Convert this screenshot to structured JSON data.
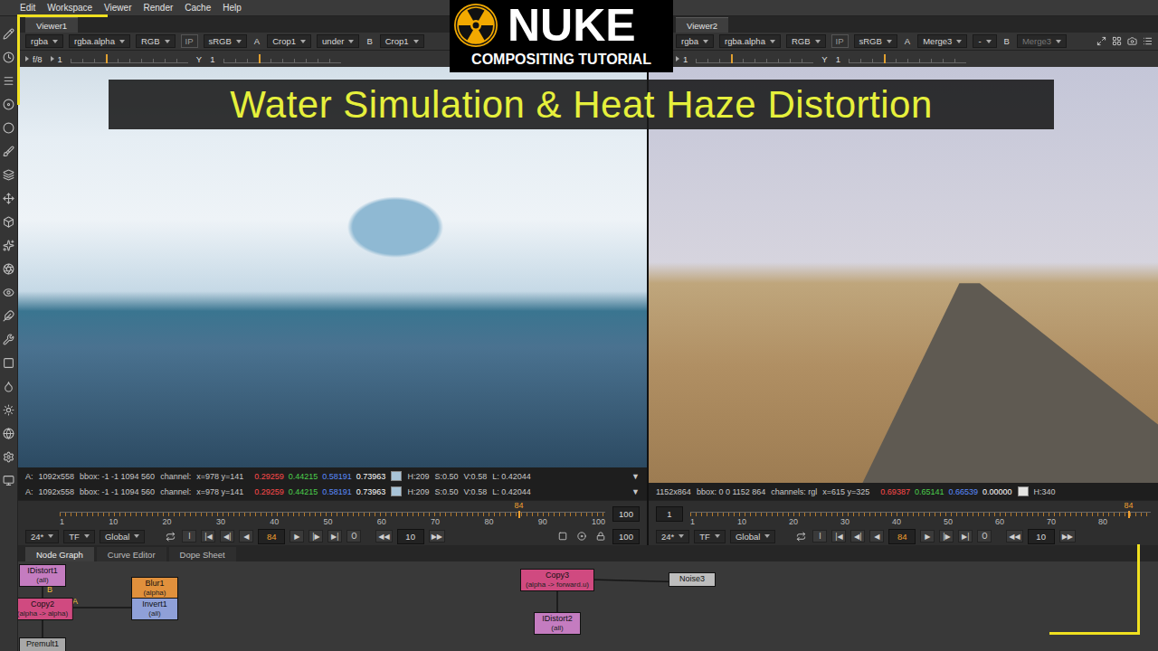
{
  "menu": [
    "Edit",
    "Workspace",
    "Viewer",
    "Render",
    "Cache",
    "Help"
  ],
  "logo": {
    "title": "NUKE",
    "subtitle": "COMPOSITING TUTORIAL"
  },
  "banner": {
    "title": "Water Simulation & Heat Haze Distortion"
  },
  "viewers": [
    {
      "tab": {
        "label": "Viewer1",
        "selected": true
      },
      "controls": [
        {
          "kind": "dropdown",
          "text": "rgba",
          "disabled": false
        },
        {
          "kind": "dropdown",
          "text": "rgba.alpha",
          "disabled": false
        },
        {
          "kind": "dropdown",
          "text": "RGB",
          "disabled": false
        },
        {
          "kind": "toggle",
          "text": "IP",
          "disabled": false
        },
        {
          "kind": "dropdown",
          "text": "sRGB",
          "disabled": false
        },
        {
          "kind": "label",
          "text": "A",
          "disabled": false
        },
        {
          "kind": "dropdown",
          "text": "Crop1",
          "disabled": false
        },
        {
          "kind": "dropdown",
          "text": "under",
          "disabled": false
        },
        {
          "kind": "label",
          "text": "B",
          "disabled": false
        },
        {
          "kind": "dropdown",
          "text": "Crop1",
          "disabled": false
        }
      ],
      "settings": [
        {
          "kind": "text",
          "text": "f/8",
          "arrow": true
        },
        {
          "kind": "text",
          "text": "1",
          "arrow": true
        },
        {
          "kind": "slider",
          "level": 0.3
        },
        {
          "kind": "text",
          "text": "Y",
          "arrow": false
        },
        {
          "kind": "text",
          "text": "1",
          "arrow": false
        },
        {
          "kind": "slider",
          "level": 0.3
        }
      ],
      "image": {
        "kind": "iceberg"
      },
      "info": [
        {
          "segments": [
            "A:",
            "1092x558",
            "bbox: -1 -1 1094 560",
            "channel:",
            "x=978 y=141"
          ],
          "values": [
            {
              "text": "0.29259",
              "color": "#ff4a4a"
            },
            {
              "text": "0.44215",
              "color": "#4cd04c"
            },
            {
              "text": "0.58191",
              "color": "#5b8cff"
            },
            {
              "text": "0.73963",
              "color": "#ffffff"
            }
          ],
          "swatch": "#a9c4d8",
          "hsv": [
            "H:209",
            "S:0.50",
            "V:0.58",
            "L: 0.42044"
          ],
          "arrow": "▼"
        },
        {
          "segments": [
            "A:",
            "1092x558",
            "bbox: -1 -1 1094 560",
            "channel:",
            "x=978 y=141"
          ],
          "values": [
            {
              "text": "0.29259",
              "color": "#ff4a4a"
            },
            {
              "text": "0.44215",
              "color": "#4cd04c"
            },
            {
              "text": "0.58191",
              "color": "#5b8cff"
            },
            {
              "text": "0.73963",
              "color": "#ffffff"
            }
          ],
          "swatch": "#a9c4d8",
          "hsv": [
            "H:209",
            "S:0.50",
            "V:0.58",
            "L: 0.42044"
          ],
          "arrow": "▼"
        }
      ],
      "timeline": {
        "ticks": [
          "1",
          "10",
          "20",
          "30",
          "40",
          "50",
          "60",
          "70",
          "80",
          "90",
          "100"
        ],
        "current": "84",
        "level": 0.84,
        "field": {
          "text": "100",
          "side": "right"
        }
      },
      "playback": {
        "selects": [
          "24*",
          "TF",
          "Global"
        ],
        "transport_back": [
          "I",
          "|◀",
          "◀|",
          "◀"
        ],
        "frame": "84",
        "transport_fwd": [
          "▶",
          "|▶",
          "▶|",
          "O"
        ],
        "step": {
          "back": "◀◀",
          "value": "10",
          "forward": "▶▶"
        },
        "end": "100"
      }
    },
    {
      "tab": {
        "label": "Viewer2",
        "selected": true
      },
      "controls": [
        {
          "kind": "dropdown",
          "text": "rgba",
          "disabled": false
        },
        {
          "kind": "dropdown",
          "text": "rgba.alpha",
          "disabled": false
        },
        {
          "kind": "dropdown",
          "text": "RGB",
          "disabled": false
        },
        {
          "kind": "toggle",
          "text": "IP",
          "disabled": false
        },
        {
          "kind": "dropdown",
          "text": "sRGB",
          "disabled": false
        },
        {
          "kind": "label",
          "text": "A",
          "disabled": false
        },
        {
          "kind": "dropdown",
          "text": "Merge3",
          "disabled": false
        },
        {
          "kind": "dropdown",
          "text": "-",
          "disabled": false
        },
        {
          "kind": "label",
          "text": "B",
          "disabled": false
        },
        {
          "kind": "dropdown",
          "text": "Merge3",
          "disabled": true
        }
      ],
      "settings": [
        {
          "kind": "text",
          "text": "1",
          "arrow": true
        },
        {
          "kind": "slider",
          "level": 0.3
        },
        {
          "kind": "text",
          "text": "Y",
          "arrow": false
        },
        {
          "kind": "text",
          "text": "1",
          "arrow": false
        },
        {
          "kind": "slider",
          "level": 0.3
        }
      ],
      "image": {
        "kind": "desert"
      },
      "info": [
        {
          "segments": [
            "1152x864",
            "bbox: 0 0 1152 864",
            "channels: rgl",
            "x=615 y=325"
          ],
          "values": [
            {
              "text": "0.69387",
              "color": "#ff4a4a"
            },
            {
              "text": "0.65141",
              "color": "#4cd04c"
            },
            {
              "text": "0.66539",
              "color": "#5b8cff"
            },
            {
              "text": "0.00000",
              "color": "#ffffff"
            }
          ],
          "swatch": "#e4e4e2",
          "hsv": [
            "H:340"
          ]
        }
      ],
      "timeline": {
        "ticks": [
          "1",
          "10",
          "20",
          "30",
          "40",
          "50",
          "60",
          "70",
          "80"
        ],
        "current": "84",
        "level": 0.95,
        "field": {
          "text": "1",
          "side": "left"
        }
      },
      "playback": {
        "selects": [
          "24*",
          "TF",
          "Global"
        ],
        "transport_back": [
          "I",
          "|◀",
          "◀|",
          "◀"
        ],
        "frame": "84",
        "transport_fwd": [
          "▶",
          "|▶",
          "▶|",
          "O"
        ],
        "step": {
          "back": "◀◀",
          "value": "10",
          "forward": "▶▶"
        }
      }
    }
  ],
  "node_graph": {
    "tabs": [
      {
        "label": "Node Graph",
        "selected": true
      },
      {
        "label": "Curve Editor",
        "selected": false
      },
      {
        "label": "Dope Sheet",
        "selected": false
      }
    ],
    "nodes": [
      {
        "name": "IDistort1",
        "sub": "(all)",
        "color": "#c47cc0"
      },
      {
        "name": "Copy2",
        "sub": "(alpha -> alpha)",
        "color": "#d04a80"
      },
      {
        "name": "Blur1",
        "sub": "(alpha)",
        "color": "#e0903c"
      },
      {
        "name": "Invert1",
        "sub": "(all)",
        "color": "#8fa0d8"
      },
      {
        "name": "Premult1",
        "color": "#a8a8a8"
      },
      {
        "name": "Copy3",
        "sub": "(alpha -> forward.u)",
        "color": "#d04a80"
      },
      {
        "name": "IDistort2",
        "sub": "(all)",
        "color": "#c47cc0"
      },
      {
        "name": "Noise3",
        "color": "#bdbdbd"
      }
    ],
    "edges": [
      {
        "from": "IDistort1",
        "to": "Copy2",
        "label": "B"
      },
      {
        "from": "Invert1",
        "to": "Copy2",
        "label": "A"
      },
      {
        "from": "Copy2",
        "to": "Premult1"
      },
      {
        "from": "Noise3",
        "to": "Copy3"
      },
      {
        "from": "Copy3",
        "to": "IDistort2"
      }
    ]
  }
}
